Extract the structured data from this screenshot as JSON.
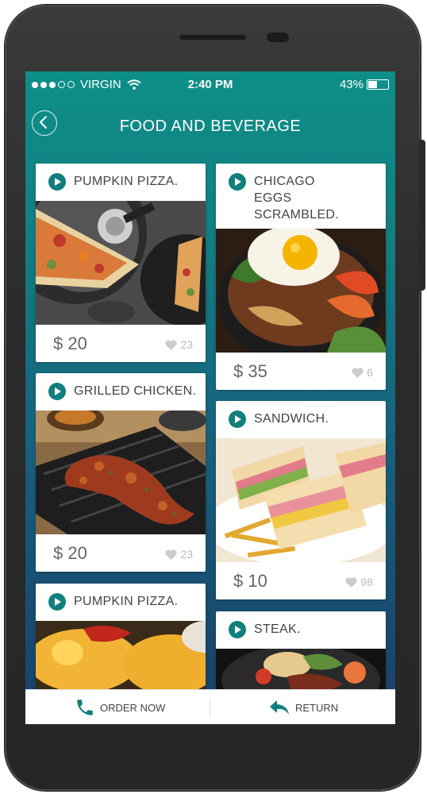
{
  "status": {
    "carrier": "VIRGIN",
    "time": "2:40 PM",
    "battery": "43%",
    "signal_bars": 3,
    "signal_total": 5,
    "battery_level": 0.43
  },
  "header": {
    "title": "FOOD AND BEVERAGE"
  },
  "cards": [
    {
      "name": "PUMPKIN PIZZA.",
      "price": "$ 20",
      "likes": "23"
    },
    {
      "name": "CHICAGO EGGS SCRAMBLED.",
      "name_lines": [
        "CHICAGO",
        "EGGS",
        "SCRAMBLED."
      ],
      "price": "$ 35",
      "likes": "6"
    },
    {
      "name": "GRILLED CHICKEN.",
      "price": "$ 20",
      "likes": "23"
    },
    {
      "name": "SANDWICH.",
      "price": "$ 10",
      "likes": "98"
    },
    {
      "name": "PUMPKIN PIZZA."
    },
    {
      "name": "STEAK."
    }
  ],
  "bottom_bar": {
    "order_label": "ORDER NOW",
    "return_label": "RETURN"
  },
  "colors": {
    "accent": "#117f7c",
    "teal_top": "#0e8f88",
    "navy_bottom": "#1a3f6a"
  },
  "icons": {
    "back": "chevron-left-icon",
    "play": "play-icon",
    "like": "heart-icon",
    "order": "phone-icon",
    "return": "return-arrow-icon"
  }
}
